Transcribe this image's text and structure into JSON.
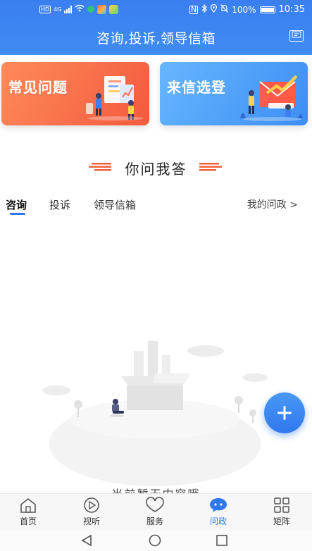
{
  "statusbar": {
    "network": "4G",
    "battery_percent": "100%",
    "time": "10:35"
  },
  "header": {
    "title": "咨询,投诉,领导信箱",
    "mailbox_icon_text": "📫"
  },
  "cards": [
    {
      "label": "常见问题",
      "color": "#f25a3e"
    },
    {
      "label": "来信选登",
      "color": "#3d8ef4"
    }
  ],
  "section": {
    "title": "你问我答"
  },
  "tabs": [
    {
      "label": "咨询",
      "active": true
    },
    {
      "label": "投诉",
      "active": false
    },
    {
      "label": "领导信箱",
      "active": false
    }
  ],
  "my_link": "我的问政 >",
  "empty": {
    "text": "当前暂无内容哦"
  },
  "bottom_nav": [
    {
      "label": "首页",
      "icon": "home-icon"
    },
    {
      "label": "视听",
      "icon": "play-icon"
    },
    {
      "label": "服务",
      "icon": "heart-icon"
    },
    {
      "label": "问政",
      "icon": "chat-icon",
      "active": true
    },
    {
      "label": "矩阵",
      "icon": "grid-icon"
    }
  ],
  "colors": {
    "primary": "#2f78ec",
    "header": "#3a7ff0",
    "faq_card": "#f25a3e",
    "letters_card": "#3d8ef4"
  }
}
